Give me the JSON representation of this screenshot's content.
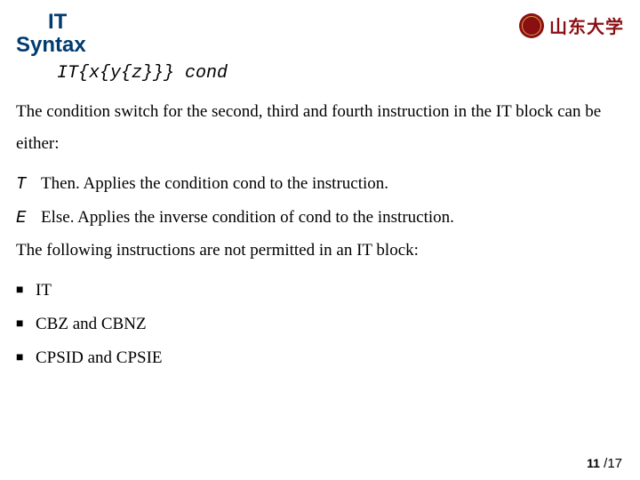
{
  "title": {
    "line1": "IT",
    "line2": "Syntax"
  },
  "logo": {
    "text": "山东大学"
  },
  "syntax": "IT{x{y{z}}} cond",
  "para1": "The condition switch for the second, third and fourth instruction in the IT block can be either:",
  "defs": [
    {
      "term": "T",
      "desc": "Then. Applies the condition cond to the instruction."
    },
    {
      "term": "E",
      "desc": "Else. Applies the inverse condition of cond to the instruction."
    }
  ],
  "para2": "The following instructions are not permitted in an IT block:",
  "bullets": [
    "IT",
    "CBZ and CBNZ",
    "CPSID and CPSIE"
  ],
  "page": {
    "current": "11",
    "total": "17"
  }
}
